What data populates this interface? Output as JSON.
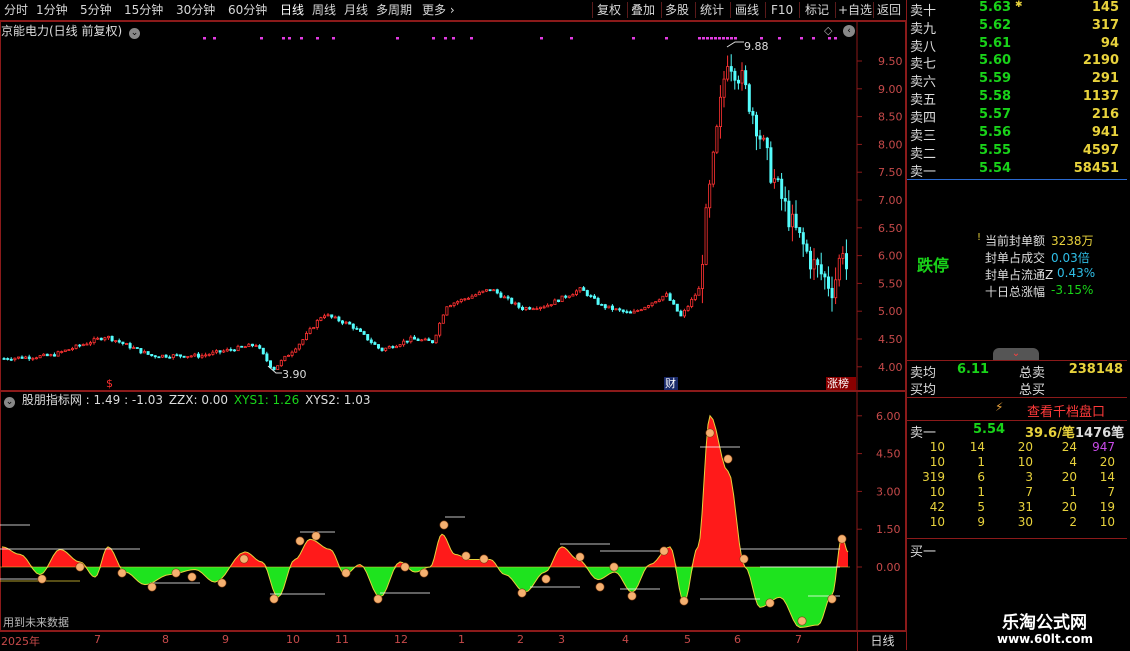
{
  "toolbar": {
    "periods": [
      "分时",
      "1分钟",
      "5分钟",
      "15分钟",
      "30分钟",
      "60分钟",
      "日线",
      "周线",
      "月线",
      "多周期",
      "更多"
    ],
    "active_period": "日线",
    "actions": [
      "复权",
      "叠加",
      "多股",
      "统计",
      "画线",
      "F10",
      "标记",
      "+自选",
      "返回"
    ]
  },
  "main_chart": {
    "title": "京能电力(日线 前复权)",
    "price_axis": [
      "9.50",
      "9.00",
      "8.50",
      "8.00",
      "7.50",
      "7.00",
      "6.50",
      "6.00",
      "5.50",
      "5.00",
      "4.50",
      "4.00"
    ],
    "high_label": "9.88",
    "low_label": "3.90",
    "markers": [
      "$",
      "财",
      "涨榜"
    ]
  },
  "indicator": {
    "name": "股朋指标网",
    "v1_text": ": 1.49",
    "v2_text": ": -1.03",
    "zzx_text": "ZZX: 0.00",
    "xys1_text": "XYS1: 1.26",
    "xys2_text": "XYS2: 1.03",
    "axis": [
      "6.00",
      "4.50",
      "3.00",
      "1.50",
      "0.00"
    ],
    "footer_note": "用到未来数据",
    "colors": {
      "positive": "#ff1a1a",
      "negative": "#1ee31e",
      "xys1": "#19d319"
    }
  },
  "date_axis": {
    "labels": [
      "2025年",
      "7",
      "8",
      "9",
      "10",
      "11",
      "12",
      "1",
      "2",
      "3",
      "4",
      "5",
      "6",
      "7"
    ],
    "period_label": "日线"
  },
  "quote": {
    "asks": [
      {
        "label": "卖十",
        "price": "5.63",
        "vol": "145"
      },
      {
        "label": "卖九",
        "price": "5.62",
        "vol": "317"
      },
      {
        "label": "卖八",
        "price": "5.61",
        "vol": "94"
      },
      {
        "label": "卖七",
        "price": "5.60",
        "vol": "2190"
      },
      {
        "label": "卖六",
        "price": "5.59",
        "vol": "291"
      },
      {
        "label": "卖五",
        "price": "5.58",
        "vol": "1137"
      },
      {
        "label": "卖四",
        "price": "5.57",
        "vol": "216"
      },
      {
        "label": "卖三",
        "price": "5.56",
        "vol": "941"
      },
      {
        "label": "卖二",
        "price": "5.55",
        "vol": "4597"
      },
      {
        "label": "卖一",
        "price": "5.54",
        "vol": "58451"
      }
    ],
    "limit_status": "跌停",
    "stats": [
      {
        "label": "当前封单额",
        "value": "3238万",
        "color": "#e8d23c"
      },
      {
        "label": "封单占成交",
        "value": "0.03倍",
        "color": "#2fbfe8"
      },
      {
        "label": "封单占流通Z",
        "value": "0.43%",
        "color": "#2fbfe8"
      },
      {
        "label": "十日总涨幅",
        "value": "-3.15%",
        "color": "#19d319"
      }
    ],
    "avg_sell_label": "卖均",
    "avg_sell_price": "6.11",
    "total_sell_label": "总卖",
    "total_sell_vol": "238148",
    "avg_buy_label": "买均",
    "total_buy_label": "总买",
    "depth_button": "查看千档盘口",
    "ask1_label": "卖一",
    "ask1_price": "5.54",
    "per_order": "39.6/笔",
    "order_count": "1476笔",
    "order_queue": [
      [
        "10",
        "14",
        "20",
        "24",
        "947"
      ],
      [
        "10",
        "1",
        "10",
        "4",
        "20"
      ],
      [
        "319",
        "6",
        "3",
        "20",
        "14"
      ],
      [
        "10",
        "1",
        "7",
        "1",
        "7"
      ],
      [
        "42",
        "5",
        "31",
        "20",
        "19"
      ],
      [
        "10",
        "9",
        "30",
        "2",
        "10"
      ]
    ],
    "bid1_label": "买一"
  },
  "watermark": {
    "title": "乐淘公式网",
    "url": "www.60lt.com"
  }
}
